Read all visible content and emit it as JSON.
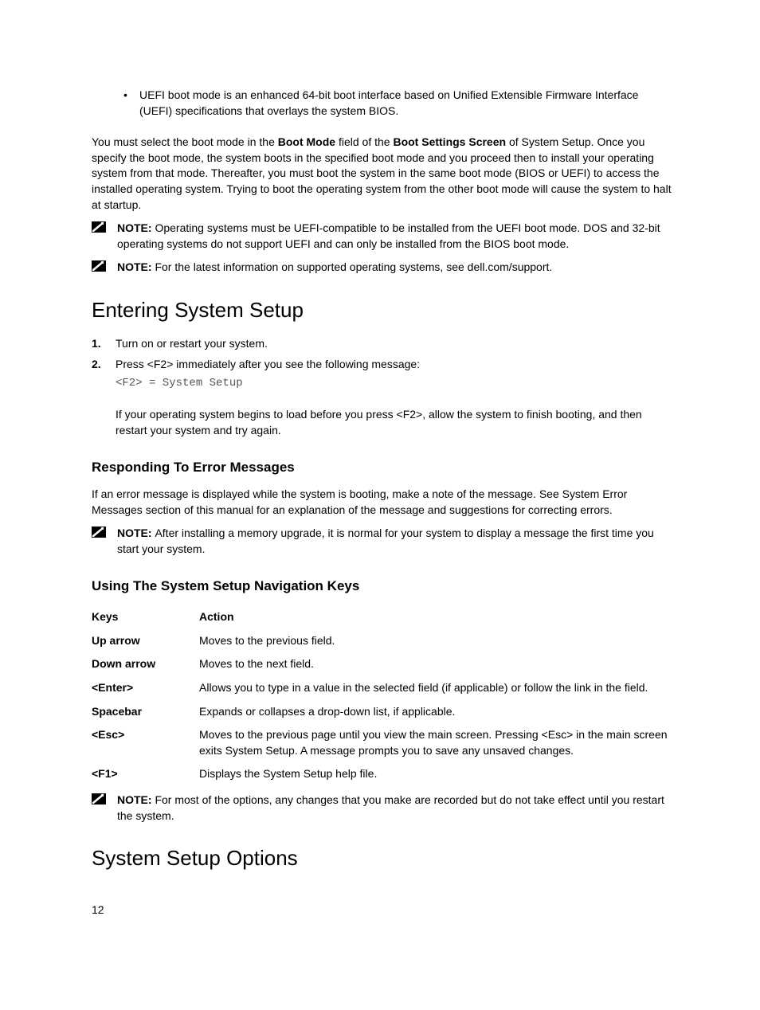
{
  "intro_bullet": "UEFI boot mode is an enhanced 64-bit boot interface based on Unified Extensible Firmware Interface (UEFI) specifications that overlays the system BIOS.",
  "intro_para_pre": "You must select the boot mode in the ",
  "intro_para_bold1": "Boot Mode",
  "intro_para_mid1": " field of the ",
  "intro_para_bold2": "Boot Settings Screen",
  "intro_para_post": " of System Setup. Once you specify the boot mode, the system boots in the specified boot mode and you proceed then to install your operating system from that mode. Thereafter, you must boot the system in the same boot mode (BIOS or UEFI) to access the installed operating system. Trying to boot the operating system from the other boot mode will cause the system to halt at startup.",
  "note1_label": "NOTE: ",
  "note1_text": "Operating systems must be UEFI-compatible to be installed from the UEFI boot mode. DOS and 32-bit operating systems do not support UEFI and can only be installed from the BIOS boot mode.",
  "note2_label": "NOTE: ",
  "note2_pre": "For the latest information on supported operating systems, see ",
  "note2_bold": "dell.com/support",
  "note2_post": ".",
  "heading1": "Entering System Setup",
  "step1_marker": "1.",
  "step1_text": "Turn on or restart your system.",
  "step2_marker": "2.",
  "step2_text": "Press <F2> immediately after you see the following message:",
  "step2_code": "<F2> = System Setup",
  "step2_followup": "If your operating system begins to load before you press <F2>, allow the system to finish booting, and then restart your system and try again.",
  "heading2": "Responding To Error Messages",
  "err_para": "If an error message is displayed while the system is booting, make a note of the message. See System Error Messages section of this manual for an explanation of the message and suggestions for correcting errors.",
  "note3_label": "NOTE: ",
  "note3_text": "After installing a memory upgrade, it is normal for your system to display a message the first time you start your system.",
  "heading3": "Using The System Setup Navigation Keys",
  "nav_header_key": "Keys",
  "nav_header_action": "Action",
  "nav_rows": [
    {
      "key": "Up arrow",
      "action": "Moves to the previous field."
    },
    {
      "key": "Down arrow",
      "action": "Moves to the next field."
    },
    {
      "key": "<Enter>",
      "action": "Allows you to type in a value in the selected field (if applicable) or follow the link in the field."
    },
    {
      "key": "Spacebar",
      "action": "Expands or collapses a drop-down list, if applicable."
    },
    {
      "key": "<Esc>",
      "action": "Moves to the previous page until you view the main screen. Pressing <Esc> in the main screen exits System Setup. A message prompts you to save any unsaved changes."
    },
    {
      "key": "<F1>",
      "action": "Displays the System Setup help file."
    }
  ],
  "note4_label": "NOTE: ",
  "note4_text": "For most of the options, any changes that you make are recorded but do not take effect until you restart the system.",
  "heading4": "System Setup Options",
  "page_number": "12"
}
